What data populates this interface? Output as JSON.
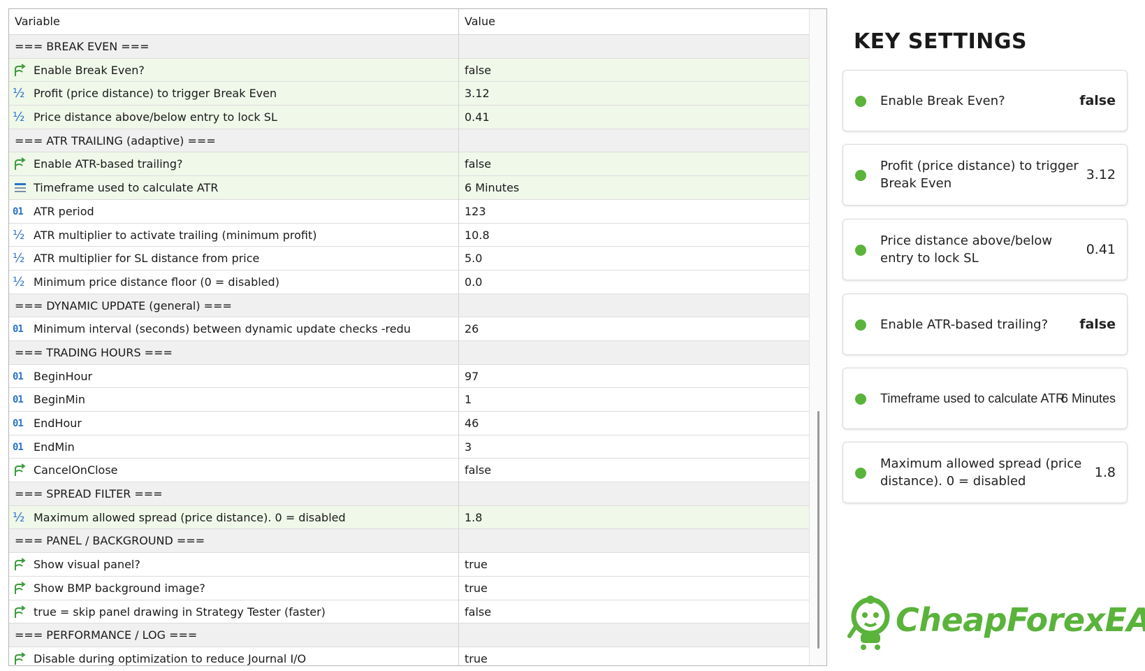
{
  "table": {
    "headers": {
      "variable": "Variable",
      "value": "Value"
    },
    "rows": [
      {
        "type": "section",
        "label": "=== BREAK EVEN ===",
        "value": "",
        "icon": ""
      },
      {
        "type": "bool",
        "label": "Enable Break Even?",
        "value": "false",
        "icon": "bool-arrow-icon",
        "highlight": true
      },
      {
        "type": "double",
        "label": "Profit (price distance) to trigger Break Even",
        "value": "3.12",
        "icon": "half-fraction-icon",
        "highlight": true
      },
      {
        "type": "double",
        "label": "Price distance above/below entry to lock SL",
        "value": "0.41",
        "icon": "half-fraction-icon",
        "highlight": true
      },
      {
        "type": "section",
        "label": "=== ATR TRAILING (adaptive) ===",
        "value": "",
        "icon": ""
      },
      {
        "type": "bool",
        "label": "Enable ATR-based trailing?",
        "value": "false",
        "icon": "bool-arrow-icon",
        "highlight": true
      },
      {
        "type": "enum",
        "label": "Timeframe used to calculate ATR",
        "value": "6 Minutes",
        "icon": "enum-list-icon",
        "highlight": true
      },
      {
        "type": "int",
        "label": "ATR period",
        "value": "123",
        "icon": "int-01-icon",
        "highlight": false
      },
      {
        "type": "double",
        "label": "ATR multiplier to activate trailing (minimum profit)",
        "value": "10.8",
        "icon": "half-fraction-icon",
        "highlight": false
      },
      {
        "type": "double",
        "label": "ATR multiplier for SL distance from price",
        "value": "5.0",
        "icon": "half-fraction-icon",
        "highlight": false
      },
      {
        "type": "double",
        "label": "Minimum price distance floor (0 = disabled)",
        "value": "0.0",
        "icon": "half-fraction-icon",
        "highlight": false
      },
      {
        "type": "section",
        "label": "=== DYNAMIC UPDATE (general) ===",
        "value": "",
        "icon": ""
      },
      {
        "type": "int",
        "label": "Minimum interval (seconds) between dynamic update checks -redu",
        "value": "26",
        "icon": "int-01-icon",
        "highlight": false
      },
      {
        "type": "section",
        "label": "=== TRADING HOURS ===",
        "value": "",
        "icon": ""
      },
      {
        "type": "int",
        "label": "BeginHour",
        "value": "97",
        "icon": "int-01-icon",
        "highlight": false
      },
      {
        "type": "int",
        "label": "BeginMin",
        "value": "1",
        "icon": "int-01-icon",
        "highlight": false
      },
      {
        "type": "int",
        "label": "EndHour",
        "value": "46",
        "icon": "int-01-icon",
        "highlight": false
      },
      {
        "type": "int",
        "label": "EndMin",
        "value": "3",
        "icon": "int-01-icon",
        "highlight": false
      },
      {
        "type": "bool",
        "label": "CancelOnClose",
        "value": "false",
        "icon": "bool-arrow-icon",
        "highlight": false
      },
      {
        "type": "section",
        "label": "=== SPREAD FILTER ===",
        "value": "",
        "icon": ""
      },
      {
        "type": "double",
        "label": "Maximum allowed spread (price distance). 0 = disabled",
        "value": "1.8",
        "icon": "half-fraction-icon",
        "highlight": true
      },
      {
        "type": "section",
        "label": "=== PANEL / BACKGROUND ===",
        "value": "",
        "icon": ""
      },
      {
        "type": "bool",
        "label": "Show visual panel?",
        "value": "true",
        "icon": "bool-arrow-icon",
        "highlight": false
      },
      {
        "type": "bool",
        "label": "Show BMP background image?",
        "value": "true",
        "icon": "bool-arrow-icon",
        "highlight": false
      },
      {
        "type": "bool",
        "label": "true = skip panel drawing in Strategy Tester (faster)",
        "value": "false",
        "icon": "bool-arrow-icon",
        "highlight": false
      },
      {
        "type": "section",
        "label": "=== PERFORMANCE / LOG ===",
        "value": "",
        "icon": ""
      },
      {
        "type": "bool",
        "label": "Disable during optimization to reduce Journal I/O",
        "value": "true",
        "icon": "bool-arrow-icon",
        "highlight": false
      }
    ]
  },
  "key_settings": {
    "title": "KEY SETTINGS",
    "cards": [
      {
        "label": "Enable Break Even?",
        "value": "false"
      },
      {
        "label": "Profit (price distance) to trigger Break Even",
        "value": "3.12"
      },
      {
        "label": "Price distance above/below entry to lock SL",
        "value": "0.41"
      },
      {
        "label": "Enable ATR-based trailing?",
        "value": "false"
      },
      {
        "label": "Timeframe used to calculate ATR",
        "value": "6 Minutes"
      },
      {
        "label": "Maximum allowed spread (price distance). 0 = disabled",
        "value": "1.8"
      }
    ]
  },
  "logo": {
    "text": "CheapForexEA",
    "icon": "mascot-icon"
  },
  "colors": {
    "accent_green": "#5ab33b",
    "int_icon_blue": "#2b73c8",
    "section_bg": "#f0f0f0",
    "highlight_bg": "#f0f8ea"
  }
}
